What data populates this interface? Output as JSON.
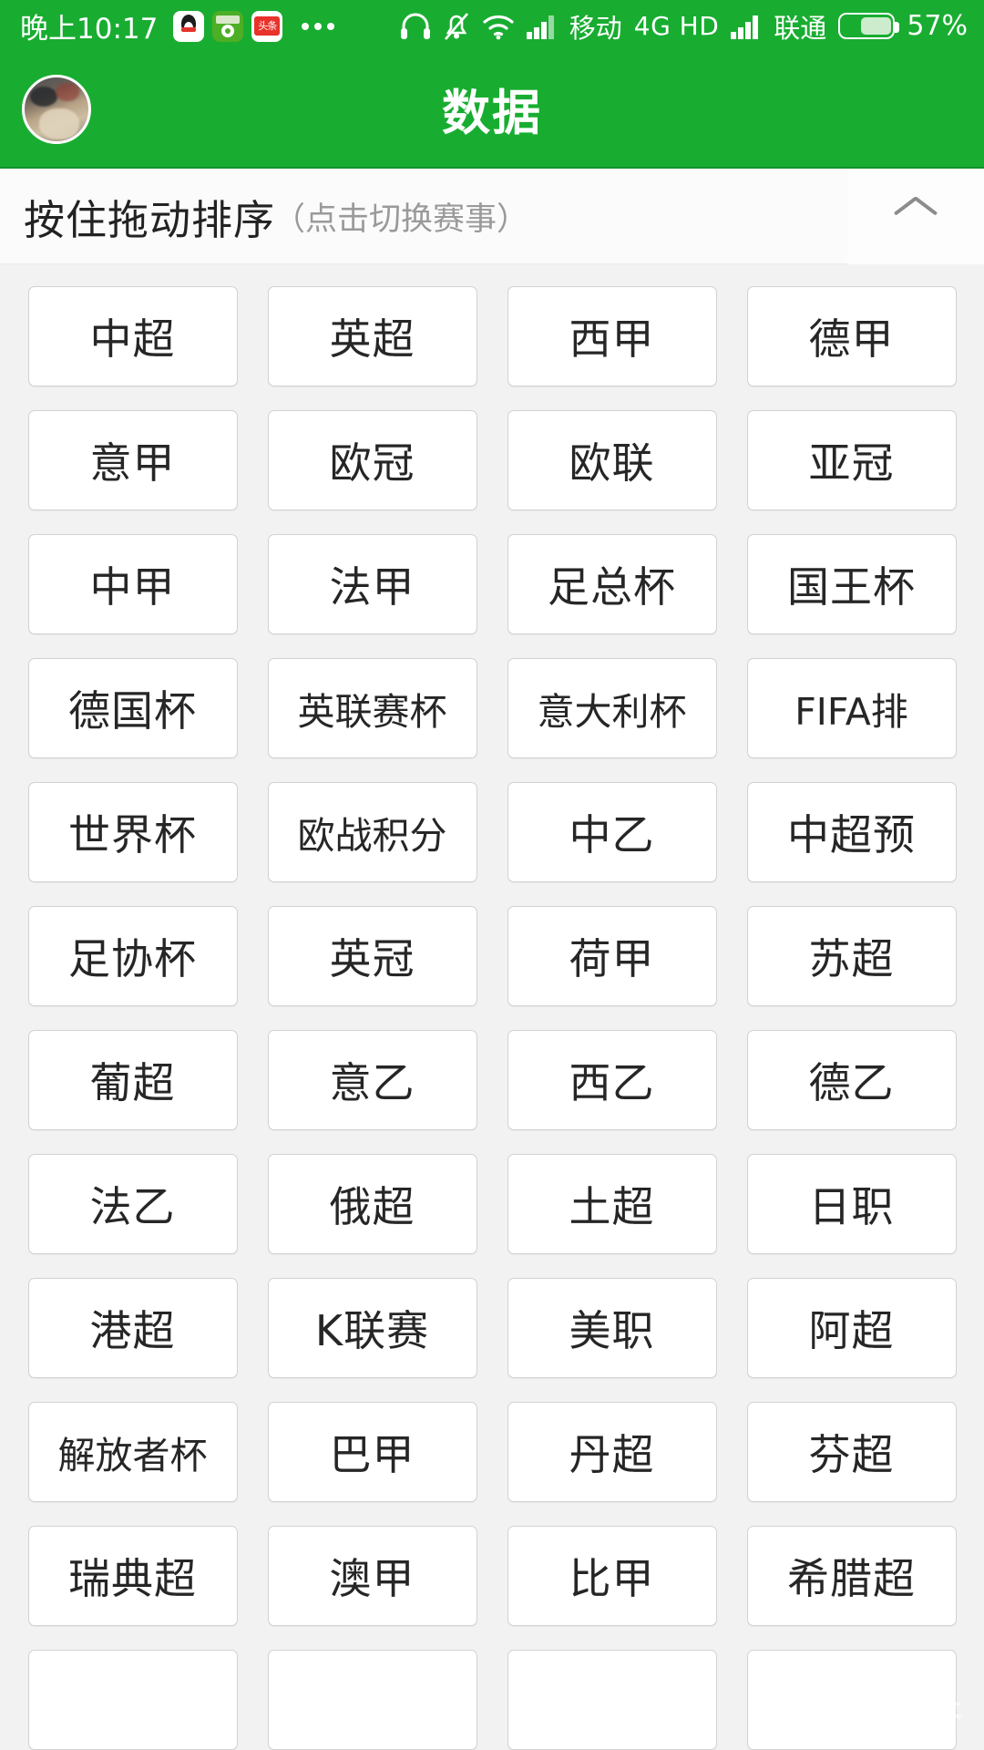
{
  "statusbar": {
    "time": "晚上10:17",
    "app_icons": [
      {
        "name": "qq-icon",
        "label": "QQ"
      },
      {
        "name": "football-app-icon",
        "label": "球"
      },
      {
        "name": "toutiao-icon",
        "label": "头条"
      }
    ],
    "overflow_dots": "...",
    "headset_icon": "headset-icon",
    "mute_icon": "bell-muted-icon",
    "wifi_icon": "wifi-icon",
    "signal_icon_1": "signal-bars-icon",
    "carrier_1": "移动",
    "network_type": "4G HD",
    "signal_icon_2": "signal-bars-icon",
    "carrier_2": "联通",
    "battery_icon": "battery-icon",
    "battery_percent": "57%",
    "battery_level": 57
  },
  "appbar": {
    "avatar": "user-avatar",
    "title": "数据"
  },
  "section": {
    "main_label": "按住拖动排序",
    "sub_label": "（点击切换赛事）",
    "toggle_icon": "chevron-up-icon"
  },
  "colors": {
    "brand_green": "#18ad31",
    "page_bg": "#f2f2f2",
    "cell_bg": "#ffffff",
    "cell_border": "#d2d2d2",
    "text_primary": "#262626",
    "text_muted": "#9a9a9a"
  },
  "leagues": [
    "中超",
    "英超",
    "西甲",
    "德甲",
    "意甲",
    "欧冠",
    "欧联",
    "亚冠",
    "中甲",
    "法甲",
    "足总杯",
    "国王杯",
    "德国杯",
    "英联赛杯",
    "意大利杯",
    "FIFA排",
    "世界杯",
    "欧战积分",
    "中乙",
    "中超预",
    "足协杯",
    "英冠",
    "荷甲",
    "苏超",
    "葡超",
    "意乙",
    "西乙",
    "德乙",
    "法乙",
    "俄超",
    "土超",
    "日职",
    "港超",
    "K联赛",
    "美职",
    "阿超",
    "解放者杯",
    "巴甲",
    "丹超",
    "芬超",
    "瑞典超",
    "澳甲",
    "比甲",
    "希腊超",
    "",
    "",
    "",
    ""
  ],
  "watermark": {
    "text": "悟空问答",
    "logo": "wukong-logo"
  }
}
